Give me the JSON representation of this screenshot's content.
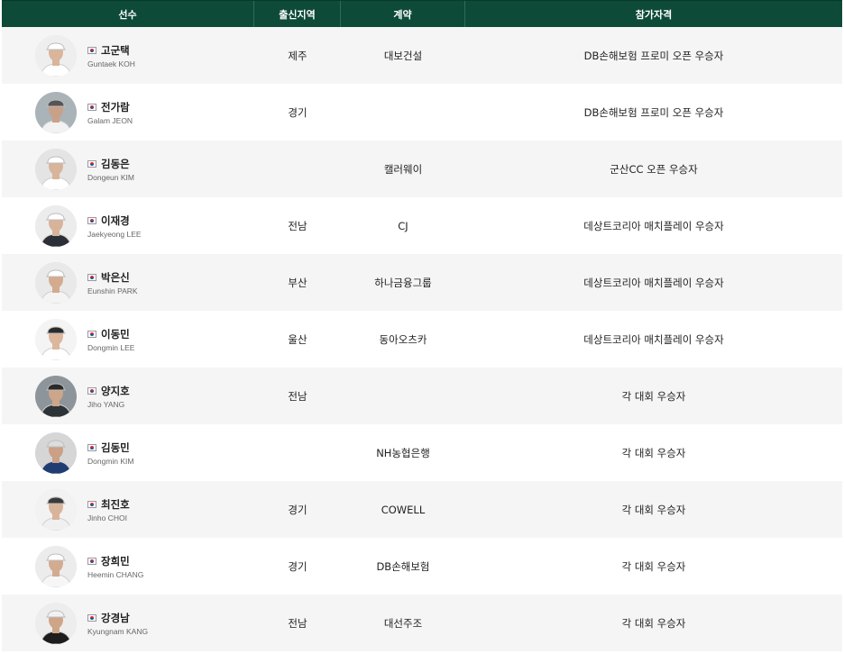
{
  "header": {
    "player": "선수",
    "region": "출신지역",
    "contract": "계약",
    "qualification": "참가자격"
  },
  "colors": {
    "header_bg": "#0d4a37",
    "row_alt": "#f5f5f5"
  },
  "players": [
    {
      "kname": "고군택",
      "ename": "Guntaek KOH",
      "region": "제주",
      "contract": "대보건설",
      "qualification": "DB손해보험 프로미 오픈 우승자",
      "shirt": "#ffffff",
      "skin": "#d9b59a",
      "cap": "#ffffff",
      "bg": "#eeeeee"
    },
    {
      "kname": "전가람",
      "ename": "Galam JEON",
      "region": "경기",
      "contract": "",
      "qualification": "DB손해보험 프로미 오픈 우승자",
      "shirt": "#f2f2f2",
      "skin": "#c9a088",
      "cap": "#555555",
      "bg": "#a9b3b8"
    },
    {
      "kname": "김동은",
      "ename": "Dongeun KIM",
      "region": "",
      "contract": "캘러웨이",
      "qualification": "군산CC 오픈 우승자",
      "shirt": "#ffffff",
      "skin": "#d8b49b",
      "cap": "#ffffff",
      "bg": "#e4e4e4"
    },
    {
      "kname": "이재경",
      "ename": "Jaekyeong LEE",
      "region": "전남",
      "contract": "CJ",
      "qualification": "데상트코리아 매치플레이 우승자",
      "shirt": "#2a2f38",
      "skin": "#d7b39a",
      "cap": "#ffffff",
      "bg": "#ececec"
    },
    {
      "kname": "박은신",
      "ename": "Eunshin PARK",
      "region": "부산",
      "contract": "하나금융그룹",
      "qualification": "데상트코리아 매치플레이 우승자",
      "shirt": "#f4f4f4",
      "skin": "#d4ab8f",
      "cap": "#ffffff",
      "bg": "#e9e9e9"
    },
    {
      "kname": "이동민",
      "ename": "Dongmin LEE",
      "region": "울산",
      "contract": "동아오츠카",
      "qualification": "데상트코리아 매치플레이 우승자",
      "shirt": "#ffffff",
      "skin": "#dcb79b",
      "cap": "#2b2b2b",
      "bg": "#f4f4f4"
    },
    {
      "kname": "양지호",
      "ename": "Jiho YANG",
      "region": "전남",
      "contract": "",
      "qualification": "각 대회 우승자",
      "shirt": "#2e3338",
      "skin": "#cda58a",
      "cap": "#2a2a2a",
      "bg": "#8e959a"
    },
    {
      "kname": "김동민",
      "ename": "Dongmin KIM",
      "region": "",
      "contract": "NH농협은행",
      "qualification": "각 대회 우승자",
      "shirt": "#1f3d73",
      "skin": "#caa086",
      "cap": "#dddddd",
      "bg": "#d6d6d6"
    },
    {
      "kname": "최진호",
      "ename": "Jinho CHOI",
      "region": "경기",
      "contract": "COWELL",
      "qualification": "각 대회 우승자",
      "shirt": "#f0f0f0",
      "skin": "#d9b49a",
      "cap": "#3a3a3a",
      "bg": "#f2f2f2"
    },
    {
      "kname": "장희민",
      "ename": "Heemin CHANG",
      "region": "경기",
      "contract": "DB손해보험",
      "qualification": "각 대회 우승자",
      "shirt": "#f6f6f6",
      "skin": "#d3ab90",
      "cap": "#ffffff",
      "bg": "#ececec"
    },
    {
      "kname": "강경남",
      "ename": "Kyungnam KANG",
      "region": "전남",
      "contract": "대선주조",
      "qualification": "각 대회 우승자",
      "shirt": "#1d1d1d",
      "skin": "#cfa588",
      "cap": "#f2f2f2",
      "bg": "#ededed"
    }
  ]
}
